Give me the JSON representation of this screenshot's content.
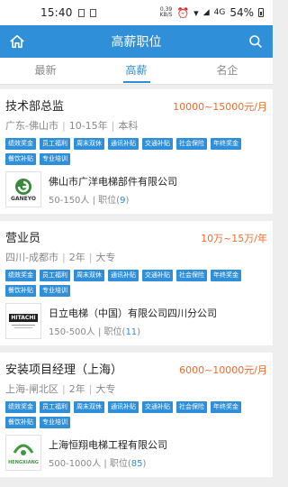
{
  "status_bar": {
    "time": "15:40",
    "net_speed_top": "0.39",
    "net_speed_bottom": "KB/S",
    "signal_label": "4G",
    "battery": "54%"
  },
  "app_bar": {
    "title": "高薪职位",
    "home_icon": "home-icon",
    "search_icon": "search-icon"
  },
  "tabs": [
    {
      "label": "最新",
      "active": false
    },
    {
      "label": "高薪",
      "active": true
    },
    {
      "label": "名企",
      "active": false
    }
  ],
  "jobs": [
    {
      "title": "技术部总监",
      "salary": "10000~15000元/月",
      "location": "广东-佛山市",
      "experience": "10-15年",
      "education": "本科",
      "tags": [
        "绩效奖金",
        "员工福利",
        "周末双休",
        "通讯补贴",
        "交通补贴",
        "社会保险",
        "年终奖金",
        "餐饮补贴",
        "专业培训"
      ],
      "company": "佛山市广洋电梯部件有限公司",
      "size": "50-150人",
      "positions_label": "职位(",
      "positions_count": "9",
      "positions_close": ")",
      "logo_text": "GANEYO"
    },
    {
      "title": "营业员",
      "salary": "10万~15万/年",
      "location": "四川-成都市",
      "experience": "2年",
      "education": "大专",
      "tags": [
        "绩效奖金",
        "员工福利",
        "周末双休",
        "通讯补贴",
        "交通补贴",
        "社会保险",
        "年终奖金",
        "餐饮补贴",
        "专业培训"
      ],
      "company": "日立电梯（中国）有限公司四川分公司",
      "size": "150-500人",
      "positions_label": "职位(",
      "positions_count": "11",
      "positions_close": ")",
      "logo_text": "HITACHI"
    },
    {
      "title": "安装项目经理（上海）",
      "salary": "6000~10000元/月",
      "location": "上海-闸北区",
      "experience": "2年",
      "education": "大专",
      "tags": [
        "绩效奖金",
        "员工福利",
        "周末双休",
        "通讯补贴",
        "交通补贴",
        "社会保险",
        "年终奖金",
        "餐饮补贴",
        "专业培训"
      ],
      "company": "上海恒翔电梯工程有限公司",
      "size": "500-1000人",
      "positions_label": "职位(",
      "positions_count": "85",
      "positions_close": ")",
      "logo_text": "HENGXIANG"
    }
  ],
  "colors": {
    "accent": "#2f8fd8",
    "salary": "#f26a2a"
  }
}
